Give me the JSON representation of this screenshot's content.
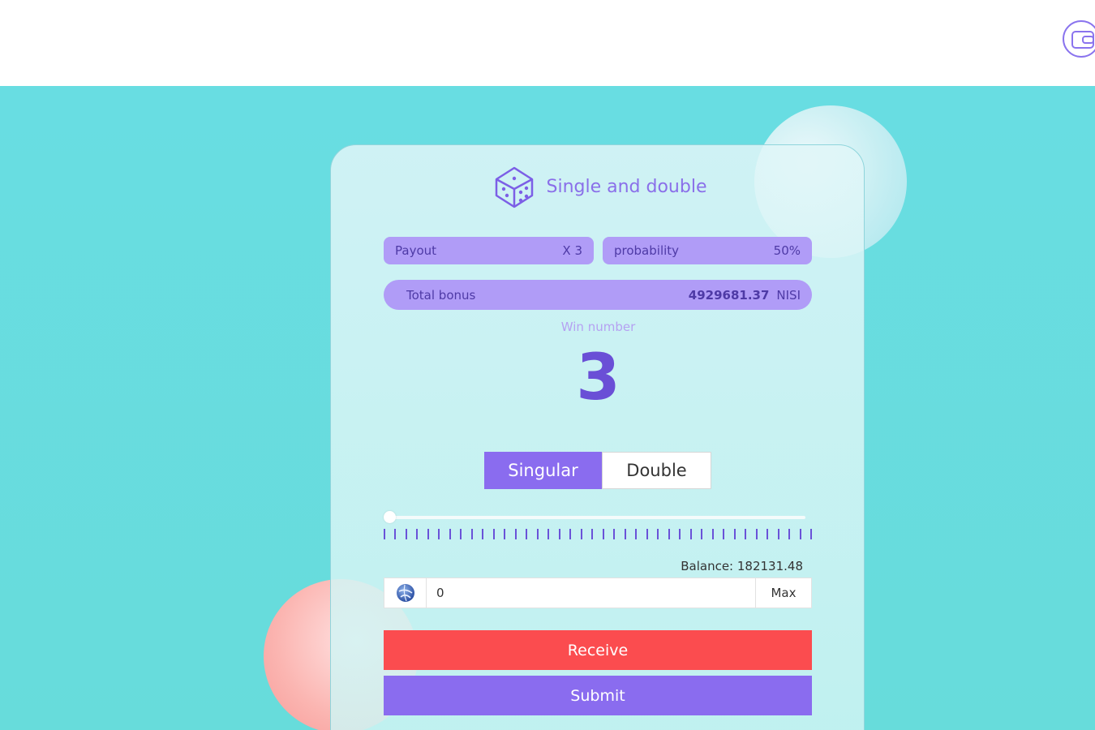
{
  "header": {
    "wallet_icon": "wallet-icon"
  },
  "game": {
    "title": "Single and double",
    "icon": "dice-icon",
    "payout": {
      "label": "Payout",
      "value": "X 3"
    },
    "probability": {
      "label": "probability",
      "value": "50%"
    },
    "total_bonus": {
      "label": "Total bonus",
      "value": "4929681.37",
      "unit": "NISI"
    },
    "win_label": "Win number",
    "win_number": "3",
    "modes": {
      "singular": "Singular",
      "double": "Double",
      "selected": "Singular"
    },
    "slider_value_fraction": 0,
    "balance": "Balance: 182131.48",
    "amount_value": "0",
    "max_label": "Max",
    "receive_label": "Receive",
    "submit_label": "Submit"
  },
  "colors": {
    "accent": "#8a6cef",
    "danger": "#fb4c4f",
    "background": "#67dcdb",
    "pill": "#b09cf7"
  }
}
